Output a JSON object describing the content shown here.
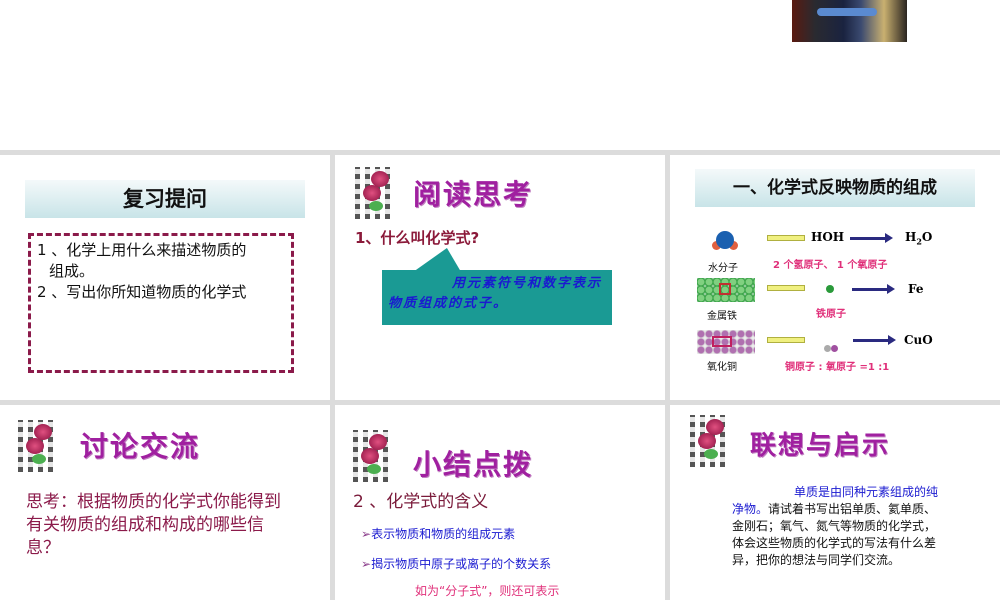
{
  "slides": {
    "review": {
      "title": "复习提问",
      "q1": "1 、化学上用什么来描述物质的",
      "q1b": "组成。",
      "q2": "2 、写出你所知道物质的化学式"
    },
    "reading": {
      "title": "阅读思考",
      "question": "1、什么叫化学式?",
      "answer": "用元素符号和数字表示物质组成的式子。"
    },
    "composition": {
      "title": "一、化学式反映物质的组成",
      "rows": [
        {
          "label": "水分子",
          "mid": "HOH",
          "formula": "H2O",
          "formula_main": "H",
          "formula_sub": "2",
          "formula_end": "O",
          "note": "2 个氢原子、 1 个氧原子"
        },
        {
          "label": "金属铁",
          "mid": "",
          "formula": "Fe",
          "note": "铁原子"
        },
        {
          "label": "氧化铜",
          "mid": "",
          "formula": "CuO",
          "note": "铜原子 : 氧原子 =1 :1"
        }
      ]
    },
    "discuss": {
      "title": "讨论交流",
      "text": "思考：根据物质的化学式你能得到有关物质的组成和构成的哪些信息？"
    },
    "summary": {
      "title": "小结点拨",
      "subtitle": "2 、化学式的含义",
      "b1": "表示物质和物质的组成元素",
      "b2": "揭示物质中原子或离子的个数关系",
      "note": "如为“分子式”，则还可表示"
    },
    "inspire": {
      "title": "联想与启示",
      "lead": "单质是由同种元素组成的纯净物。",
      "text": "请试着书写出铝单质、氦单质、金刚石；氧气、氮气等物质的化学式，体会这些物质的化学式的写法有什么差异，把你的想法与同学们交流。"
    }
  },
  "colors": {
    "title_purple": "#a020a0",
    "maroon": "#8b1a4a",
    "blue": "#1a1ad0",
    "teal": "#1a9a94",
    "pink": "#e0307a"
  }
}
